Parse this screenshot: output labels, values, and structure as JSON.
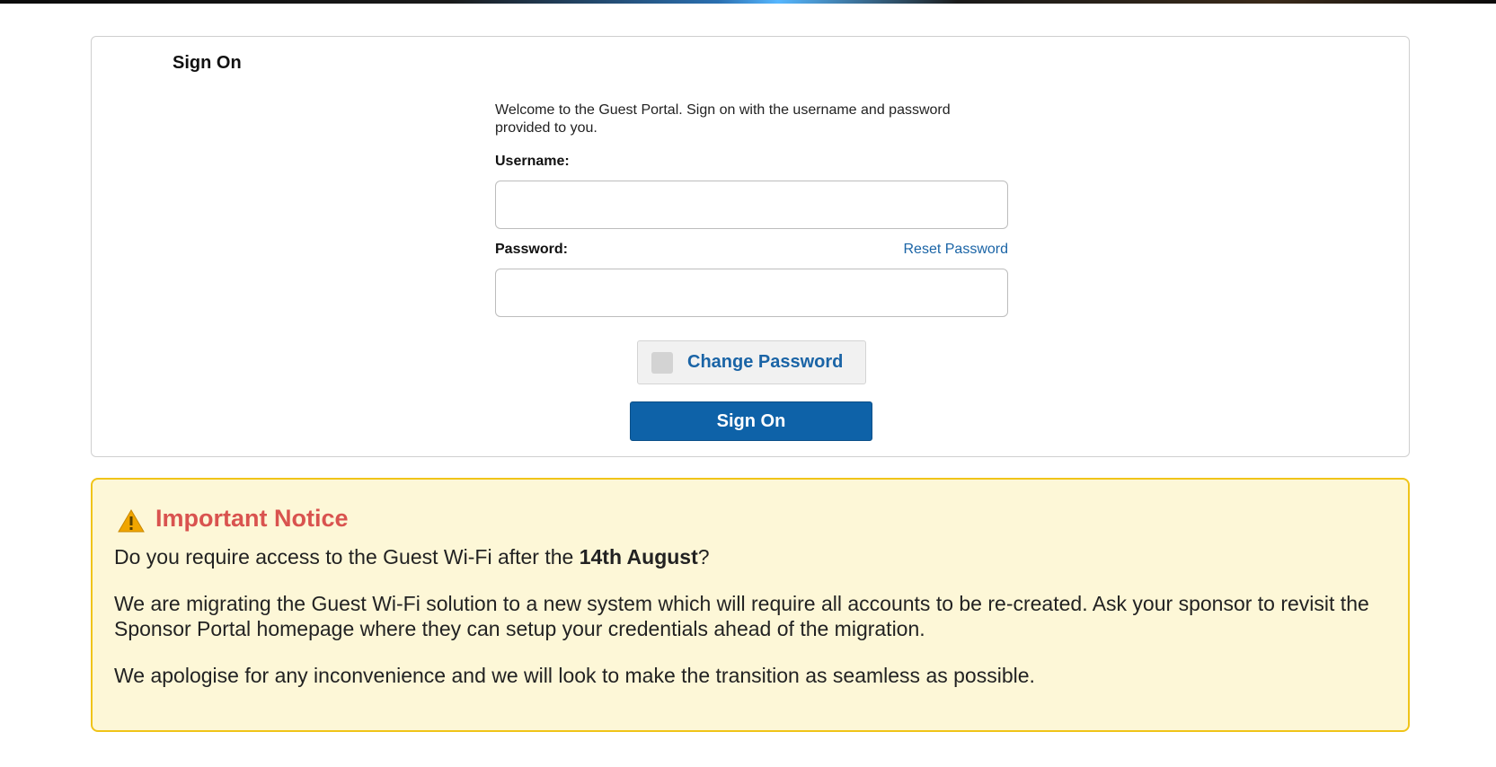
{
  "card": {
    "title": "Sign On",
    "welcome": "Welcome to the Guest Portal. Sign on with the username and password provided to you.",
    "username_label": "Username:",
    "username_value": "",
    "password_label": "Password:",
    "password_value": "",
    "reset_link": "Reset Password",
    "change_password_label": "Change Password",
    "signon_button": "Sign On"
  },
  "notice": {
    "icon": "warning-icon",
    "heading": "Important Notice",
    "q_prefix": "Do you require access to the Guest Wi-Fi after the ",
    "q_bold": "14th August",
    "q_suffix": "?",
    "p2": "We are migrating the Guest Wi-Fi solution to a new system which will require all accounts to be re-created. Ask your sponsor to revisit the Sponsor Portal homepage where they can setup your credentials ahead of the migration.",
    "p3": "We apologise for any inconvenience and we will look to make the transition as seamless as possible."
  },
  "colors": {
    "link": "#1a64a6",
    "primary_button": "#0e62a8",
    "notice_bg": "#fdf7d7",
    "notice_border": "#f0c419",
    "notice_heading": "#d9534f"
  }
}
